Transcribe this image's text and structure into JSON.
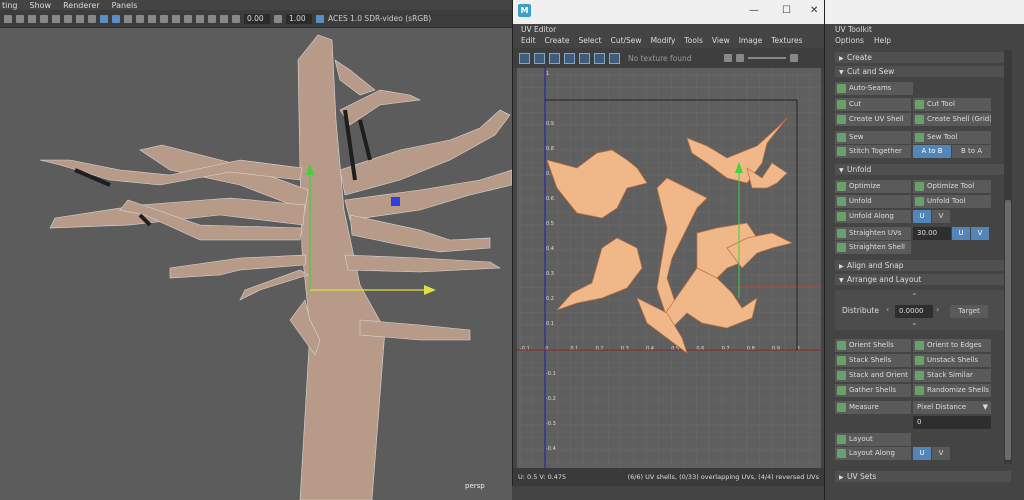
{
  "viewport": {
    "menu": [
      "ting",
      "Show",
      "Renderer",
      "Panels"
    ],
    "toolbar": {
      "value1": "0.00",
      "value2": "1.00",
      "colorspace": "ACES 1.0 SDR-video (sRGB)"
    },
    "camera_label": "persp"
  },
  "uv_editor": {
    "window_icon": "M",
    "title": "UV Editor",
    "menu": [
      "Edit",
      "Create",
      "Select",
      "Cut/Sew",
      "Modify",
      "Tools",
      "View",
      "Image",
      "Textures"
    ],
    "texture_status": "No texture found",
    "axis_labels": {
      "v": [
        "1",
        "0.9",
        "0.8",
        "0.7",
        "0.6",
        "0.5",
        "0.4",
        "0.3",
        "0.2",
        "0.1",
        "-0.1",
        "-0.2",
        "-0.3",
        "-0.4"
      ],
      "u": [
        "-0.1",
        "0",
        "0.1",
        "0.2",
        "0.3",
        "0.4",
        "0.5",
        "0.6",
        "0.7",
        "0.8",
        "0.9",
        "1"
      ]
    },
    "status_left": "U:  0.5 V:  0.475",
    "status_right": "(6/6) UV shells, (0/33) overlapping UVs, (4/4) reversed UVs"
  },
  "uv_toolkit": {
    "title": "UV Toolkit",
    "menu": [
      "Options",
      "Help"
    ],
    "window_controls": {
      "minimize": "—",
      "maximize": "☐",
      "close": "✕"
    },
    "sections": {
      "create": "Create",
      "cut_sew": "Cut and Sew",
      "unfold": "Unfold",
      "align": "Align and Snap",
      "arrange": "Arrange and Layout",
      "uvsets": "UV Sets"
    },
    "buttons": {
      "auto_seams": "Auto-Seams",
      "cut": "Cut",
      "cut_tool": "Cut Tool",
      "create_uv_shell": "Create UV Shell",
      "create_shell_grid": "Create Shell (Grid)",
      "sew": "Sew",
      "sew_tool": "Sew Tool",
      "stitch_together": "Stitch Together",
      "a_to_b": "A to B",
      "b_to_a": "B to A",
      "optimize": "Optimize",
      "optimize_tool": "Optimize Tool",
      "unfold": "Unfold",
      "unfold_tool": "Unfold Tool",
      "unfold_along": "Unfold Along",
      "u": "U",
      "v": "V",
      "straighten_uvs": "Straighten UVs",
      "straighten_value": "30.00",
      "straighten_shell": "Straighten Shell",
      "distribute": "Distribute",
      "distribute_value": "0.0000",
      "target": "Target",
      "orient_shells": "Orient Shells",
      "orient_to_edges": "Orient to Edges",
      "stack_shells": "Stack Shells",
      "unstack_shells": "Unstack Shells",
      "stack_and_orient": "Stack and Orient",
      "stack_similar": "Stack Similar",
      "gather_shells": "Gather Shells",
      "randomize_shells": "Randomize Shells",
      "measure": "Measure",
      "measure_mode": "Pixel Distance",
      "measure_value": "0",
      "layout": "Layout",
      "layout_along": "Layout Along"
    }
  }
}
